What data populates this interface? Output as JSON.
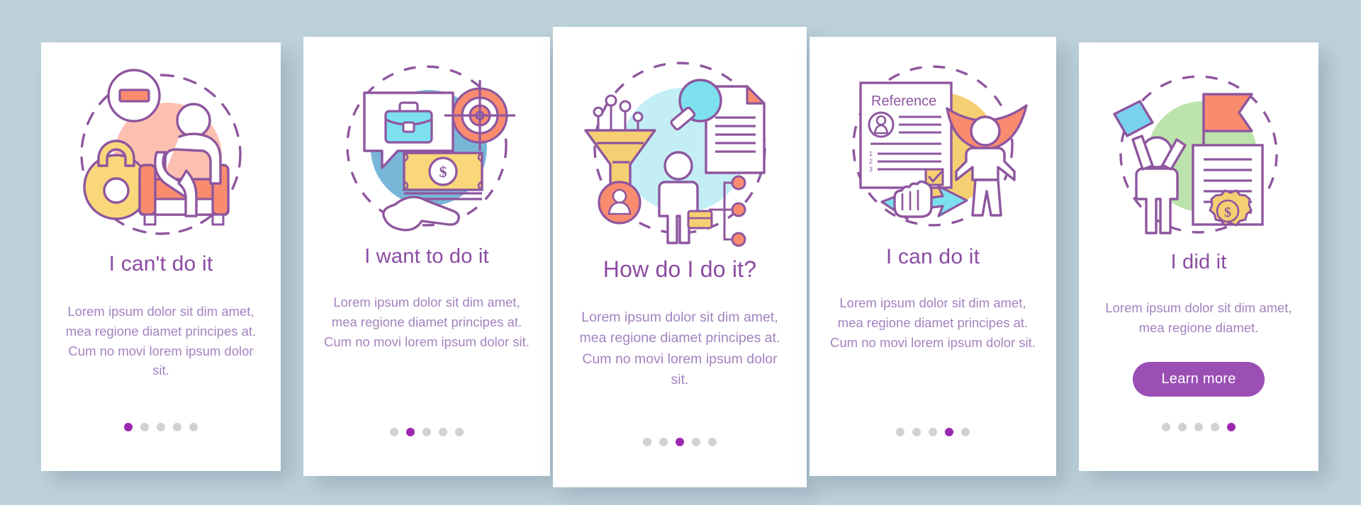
{
  "theme": {
    "background": "#bed2dc",
    "card_bg": "#ffffff",
    "title_color": "#8b4ba3",
    "body_color": "#a383c0",
    "accent": "#9b27b0",
    "button_bg": "#9b4fb5",
    "dot_inactive": "#d2d2d2",
    "line_stroke": "#8e569f",
    "coral": "#f98b6f",
    "peach": "#fbc0b0",
    "yellow": "#f7d074",
    "blue": "#79b7d9",
    "cyan": "#7ce0ef",
    "light_cyan": "#c3eef6",
    "green": "#bde3ac"
  },
  "screens": [
    {
      "id": "screen-1",
      "title": "I can't do it",
      "description": "Lorem ipsum dolor sit dim amet, mea regione diamet principes at. Cum no movi lorem ipsum dolor sit.",
      "icon": "kettlebell-person-in-armchair-minus-icon",
      "dots": {
        "total": 5,
        "active": 1
      },
      "button": null
    },
    {
      "id": "screen-2",
      "title": "I want to do it",
      "description": "Lorem ipsum dolor sit dim amet, mea regione diamet principes at. Cum no movi lorem ipsum dolor sit.",
      "icon": "briefcase-bubble-target-money-hand-icon",
      "dots": {
        "total": 5,
        "active": 2
      },
      "button": null
    },
    {
      "id": "screen-3",
      "title": "How do I do it?",
      "description": "Lorem ipsum dolor sit dim amet, mea regione diamet principes at. Cum no movi lorem ipsum dolor sit.",
      "icon": "funnel-magnifier-document-person-nodes-icon",
      "dots": {
        "total": 5,
        "active": 3
      },
      "button": null
    },
    {
      "id": "screen-4",
      "title": "I can do it",
      "description": "Lorem ipsum dolor sit dim amet, mea regione diamet principes at. Cum no movi lorem ipsum dolor sit.",
      "icon": "reference-document-superhero-thumbup-icon",
      "icon_label": "Reference",
      "dots": {
        "total": 5,
        "active": 4
      },
      "button": null
    },
    {
      "id": "screen-5",
      "title": "I did it",
      "description": "Lorem ipsum dolor sit dim amet, mea regione diamet.",
      "icon": "celebrating-person-flag-certificate-icon",
      "dots": {
        "total": 5,
        "active": 5
      },
      "button": "Learn more"
    }
  ]
}
